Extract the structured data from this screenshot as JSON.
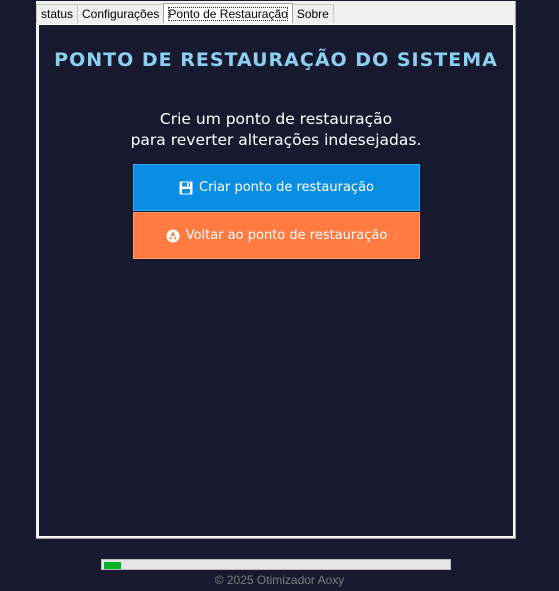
{
  "tabs": [
    {
      "label": "status"
    },
    {
      "label": "Configurações"
    },
    {
      "label": "Ponto de Restauração"
    },
    {
      "label": "Sobre"
    }
  ],
  "active_tab": "Ponto de Restauração",
  "panel": {
    "title": "PONTO DE RESTAURAÇÃO DO SISTEMA",
    "description_line1": "Crie um ponto de restauração",
    "description_line2": "para reverter alterações indesejadas.",
    "create_button": {
      "label": "Criar ponto de restauração",
      "icon": "save-icon",
      "color": "#0a8ee3"
    },
    "restore_button": {
      "label": "Voltar ao ponto de restauração",
      "icon": "recycle-icon",
      "color": "#ff7b41"
    }
  },
  "progress": {
    "value": 0.05
  },
  "footer": {
    "text": "© 2025 Otimizador Aoxy"
  },
  "colors": {
    "background": "#171a2e",
    "title": "#8ccff0",
    "progress_fill": "#06b025"
  }
}
